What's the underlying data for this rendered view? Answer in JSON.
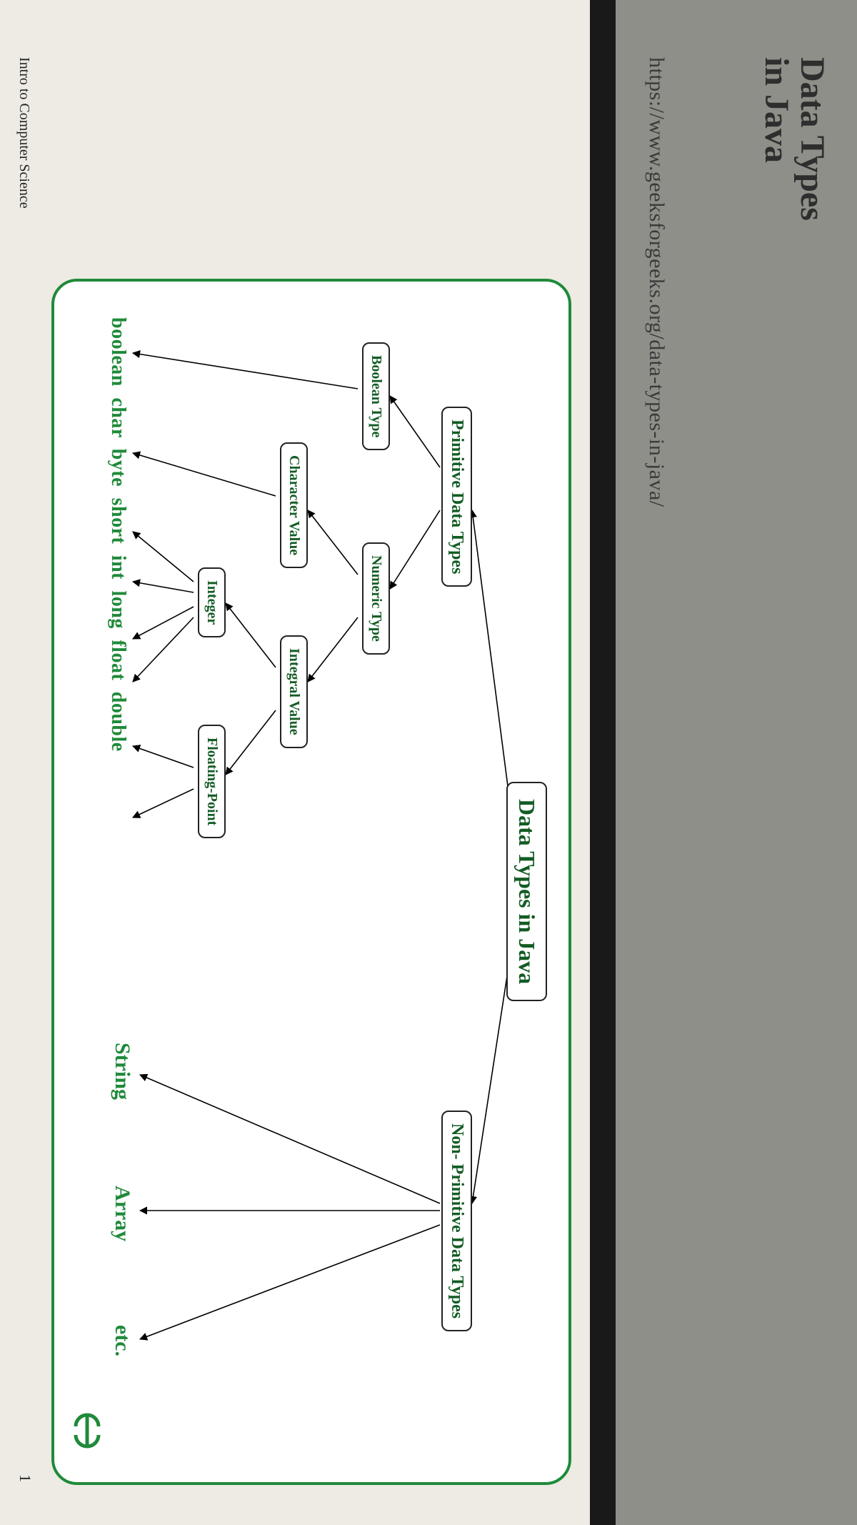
{
  "header": {
    "title_l1": "Data Types",
    "title_l2": "in Java",
    "url": "https://www.geeksforgeeks.org/data-types-in-java/"
  },
  "footer": {
    "left": "Intro to Computer Science",
    "page": "1"
  },
  "diagram": {
    "root": "Data Types in Java",
    "primitive": "Primitive Data Types",
    "nonprimitive": "Non- Primitive Data Types",
    "boolean_type": "Boolean Type",
    "numeric_type": "Numeric Type",
    "character_value": "Character Value",
    "integral_value": "Integral Value",
    "integer": "Integer",
    "floating_point": "Floating-Point",
    "leaves_row": "boolean   char    byte short  int  long    float  double",
    "np_string": "String",
    "np_array": "Array",
    "np_etc": "etc.",
    "logo": "GG"
  }
}
